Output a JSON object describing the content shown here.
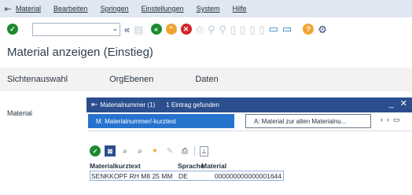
{
  "menu": {
    "items": [
      "Material",
      "Bearbeiten",
      "Springen",
      "Einstellungen",
      "System",
      "Hilfe"
    ]
  },
  "page": {
    "title": "Material anzeigen (Einstieg)"
  },
  "tabs": [
    "Sichtenauswahl",
    "OrgEbenen",
    "Daten"
  ],
  "field": {
    "label": "Material"
  },
  "popup": {
    "title": "Materialnummer (1)",
    "count": "1 Eintrag gefunden",
    "tab_active": "M: Materialnummer/-kurztext",
    "tab_inactive": "A: Material zur alten Materialnu...",
    "columns": [
      "Materialkurztext",
      "Sprache",
      "Material"
    ],
    "rows": [
      {
        "text": "SENKKOPF RH M8 25 MM",
        "lang": "DE",
        "material": "000000000000001644"
      }
    ]
  }
}
